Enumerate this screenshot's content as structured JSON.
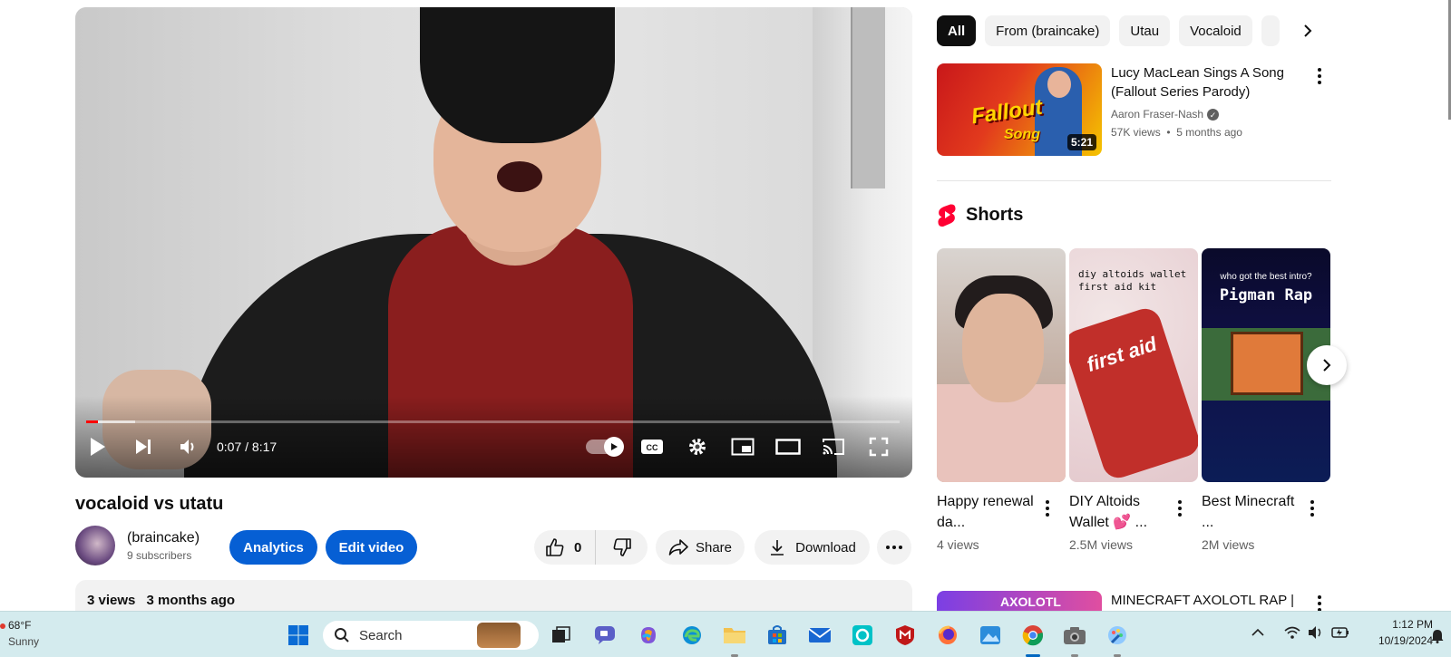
{
  "video": {
    "title": "vocaloid vs utatu",
    "time_current": "0:07",
    "time_total": "8:17",
    "time_display": "0:07 / 8:17",
    "progress_fraction": 0.014,
    "buffer_fraction": 0.06,
    "autoplay_on": true
  },
  "channel": {
    "name": "(braincake)",
    "subscribers": "9 subscribers"
  },
  "actions": {
    "analytics_label": "Analytics",
    "edit_video_label": "Edit video",
    "like_count": "0",
    "share_label": "Share",
    "download_label": "Download"
  },
  "description": {
    "views": "3 views",
    "age": "3 months ago"
  },
  "chips": [
    "All",
    "From (braincake)",
    "Utau",
    "Vocaloid"
  ],
  "recommendations": [
    {
      "title": "Lucy MacLean Sings A Song (Fallout Series Parody)",
      "channel": "Aaron Fraser-Nash",
      "verified": true,
      "views": "57K views",
      "age": "5 months ago",
      "duration": "5:21",
      "thumb_text_main": "Fallout",
      "thumb_text_sub": "Song"
    },
    {
      "title": "MINECRAFT AXOLOTL RAP |",
      "thumb_text": "AXOLOTL"
    }
  ],
  "shorts": {
    "heading": "Shorts",
    "items": [
      {
        "title": "Happy renewal da...",
        "views": "4 views"
      },
      {
        "title": "DIY Altoids Wallet 💕 ...",
        "views": "2.5M views",
        "thumb_caption": "diy altoids wallet\nfirst aid kit",
        "thumb_tin": "first aid"
      },
      {
        "title": "Best Minecraft ...",
        "views": "2M views",
        "thumb_line1": "who got the best intro?",
        "thumb_line2": "Pigman Rap"
      }
    ]
  },
  "taskbar": {
    "weather_temp": "68°F",
    "weather_cond": "Sunny",
    "search_placeholder": "Search",
    "time": "1:12 PM",
    "date": "10/19/2024"
  },
  "colors": {
    "accent_blue": "#065fd4",
    "progress_red": "#ff0000",
    "chip_bg": "#f2f2f2",
    "taskbar_bg": "#d4ebee"
  }
}
